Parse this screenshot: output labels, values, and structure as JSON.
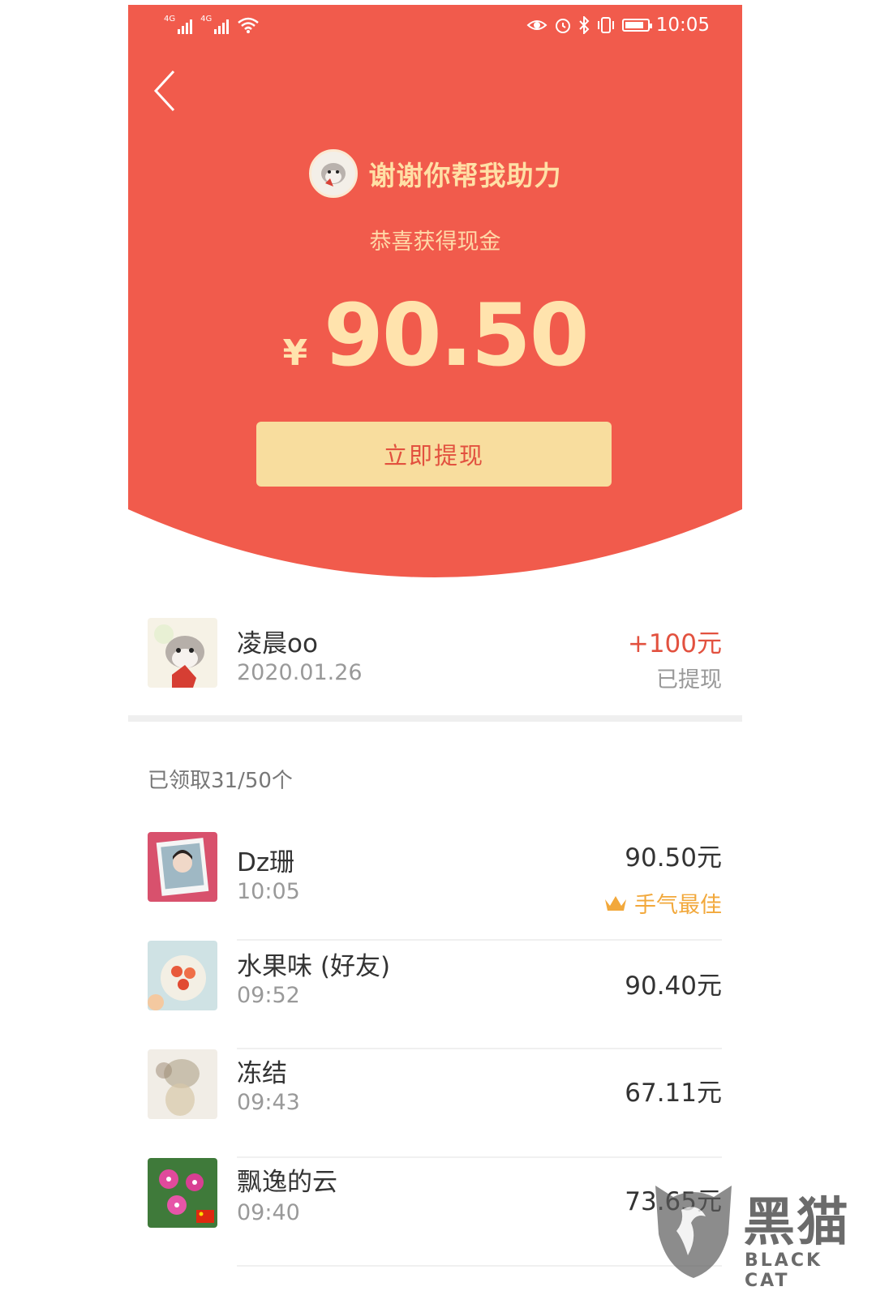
{
  "status_bar": {
    "signal_1": "4G",
    "signal_2": "4G",
    "time": "10:05"
  },
  "header": {
    "title": "谢谢你帮我助力",
    "subtitle": "恭喜获得现金",
    "currency": "¥",
    "amount": "90.50",
    "withdraw_button": "立即提现"
  },
  "my_record": {
    "name": "凌晨oo",
    "date": "2020.01.26",
    "reward": "+100元",
    "status": "已提现"
  },
  "claimed_count": "已领取31/50个",
  "list": [
    {
      "name": "Dz珊",
      "time": "10:05",
      "amount": "90.50元",
      "badge": "手气最佳"
    },
    {
      "name": "水果味 (好友)",
      "time": "09:52",
      "amount": "90.40元"
    },
    {
      "name": "冻结",
      "time": "09:43",
      "amount": "67.11元"
    },
    {
      "name": "飘逸的云",
      "time": "09:40",
      "amount": "73.65元"
    }
  ],
  "watermark": {
    "text_cn": "黑猫",
    "text_en": "BLACK CAT"
  },
  "colors": {
    "header_red": "#f15b4c",
    "button_gold": "#f8dd9e",
    "reward_red": "#e2513f",
    "best_gold": "#f2a83b"
  }
}
